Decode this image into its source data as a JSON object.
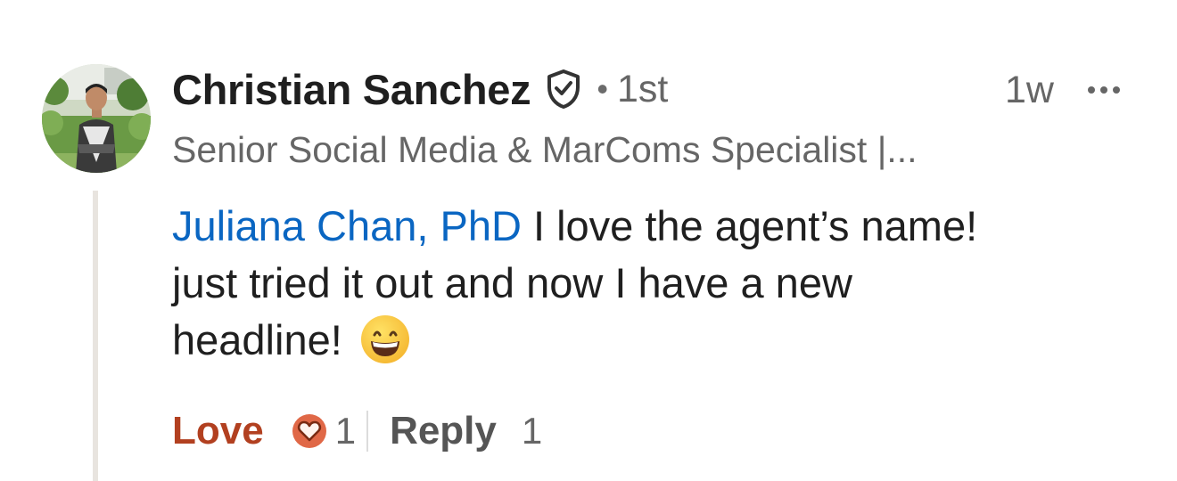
{
  "comment": {
    "author": {
      "name": "Christian Sanchez",
      "verified_icon": "shield-check-icon",
      "connection_separator": "•",
      "connection_degree": "1st",
      "headline": "Senior Social Media & MarComs Specialist |..."
    },
    "timestamp": "1w",
    "more_icon": "ellipsis-icon",
    "body": {
      "mention": "Juliana Chan, PhD",
      "text_line1": " I love the agent’s name!",
      "text_line2": "just tried it out and now I have a new",
      "text_line3": "headline!",
      "emoji": "grinning-face-emoji"
    },
    "actions": {
      "love_label": "Love",
      "love_icon": "heart-reaction-icon",
      "love_count": "1",
      "reply_label": "Reply",
      "reply_count": "1"
    }
  },
  "colors": {
    "mention": "#0a66c2",
    "love": "#b24020",
    "reaction_badge": "#e06847",
    "muted_text": "#666666",
    "primary_text": "#1f1f1f",
    "thread_line": "#e8e4df"
  }
}
